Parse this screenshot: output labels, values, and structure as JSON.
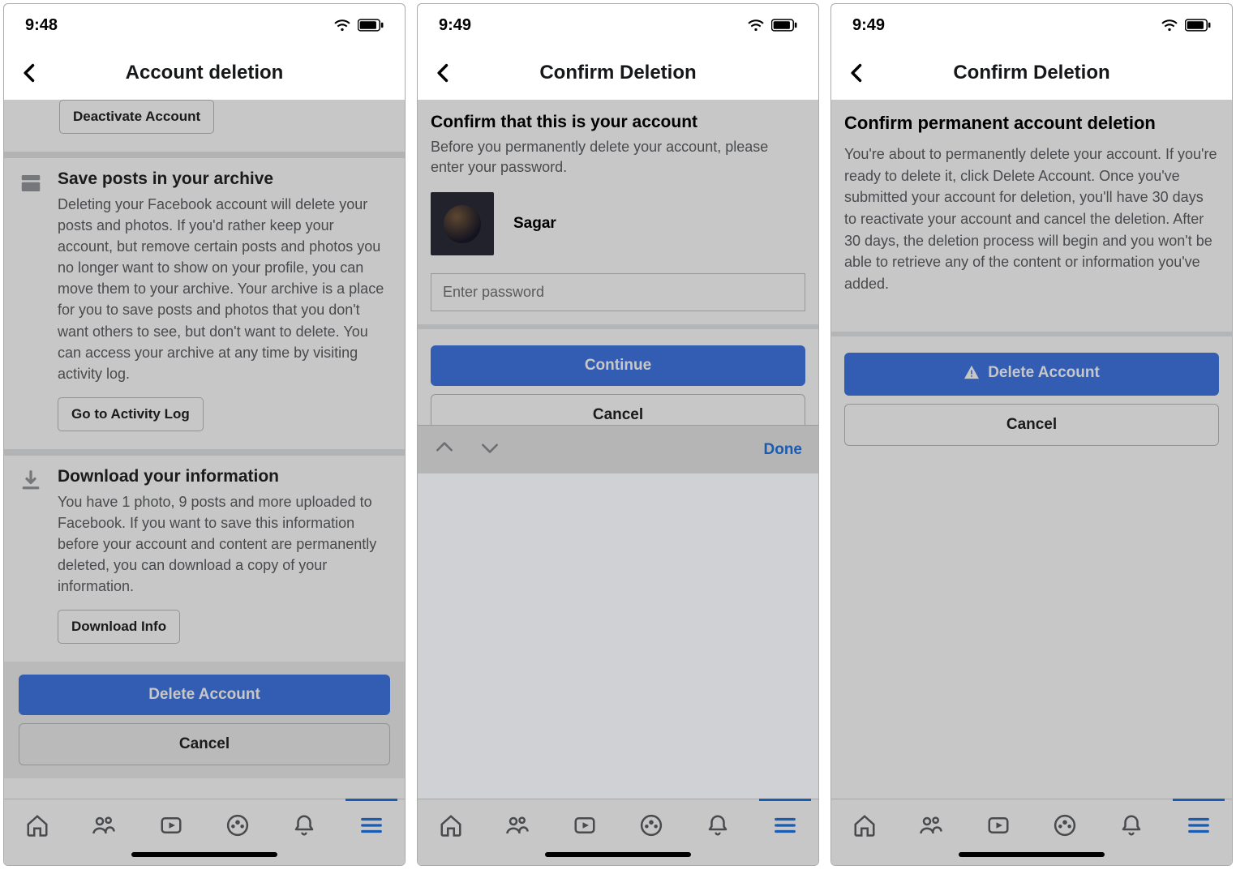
{
  "colors": {
    "accent": "#3a78f2",
    "link": "#1877f2"
  },
  "status": {
    "time_a": "9:48",
    "time_b": "9:49",
    "time_c": "9:49"
  },
  "screen1": {
    "header": "Account deletion",
    "deactivate_btn": "Deactivate Account",
    "archive": {
      "title": "Save posts in your archive",
      "body": "Deleting your Facebook account will delete your posts and photos. If you'd rather keep your account, but remove certain posts and photos you no longer want to show on your profile, you can move them to your archive. Your archive is a place for you to save posts and photos that you don't want others to see, but don't want to delete. You can access your archive at any time by visiting activity log.",
      "btn": "Go to Activity Log"
    },
    "download": {
      "title": "Download your information",
      "body": "You have 1 photo, 9 posts and more uploaded to Facebook. If you want to save this information before your account and content are permanently deleted, you can download a copy of your information.",
      "btn": "Download Info"
    },
    "delete_btn": "Delete Account",
    "cancel_btn": "Cancel"
  },
  "screen2": {
    "header": "Confirm Deletion",
    "title": "Confirm that this is your account",
    "sub": "Before you permanently delete your account, please enter your password.",
    "user_name": "Sagar",
    "pw_placeholder": "Enter password",
    "continue_btn": "Continue",
    "cancel_btn": "Cancel",
    "kb_done": "Done"
  },
  "screen3": {
    "header": "Confirm Deletion",
    "title": "Confirm permanent account deletion",
    "body": "You're about to permanently delete your account. If you're ready to delete it, click Delete Account. Once you've submitted your account for deletion, you'll have 30 days to reactivate your account and cancel the deletion. After 30 days, the deletion process will begin and you won't be able to retrieve any of the content or information you've added.",
    "delete_btn": "Delete Account",
    "cancel_btn": "Cancel"
  }
}
